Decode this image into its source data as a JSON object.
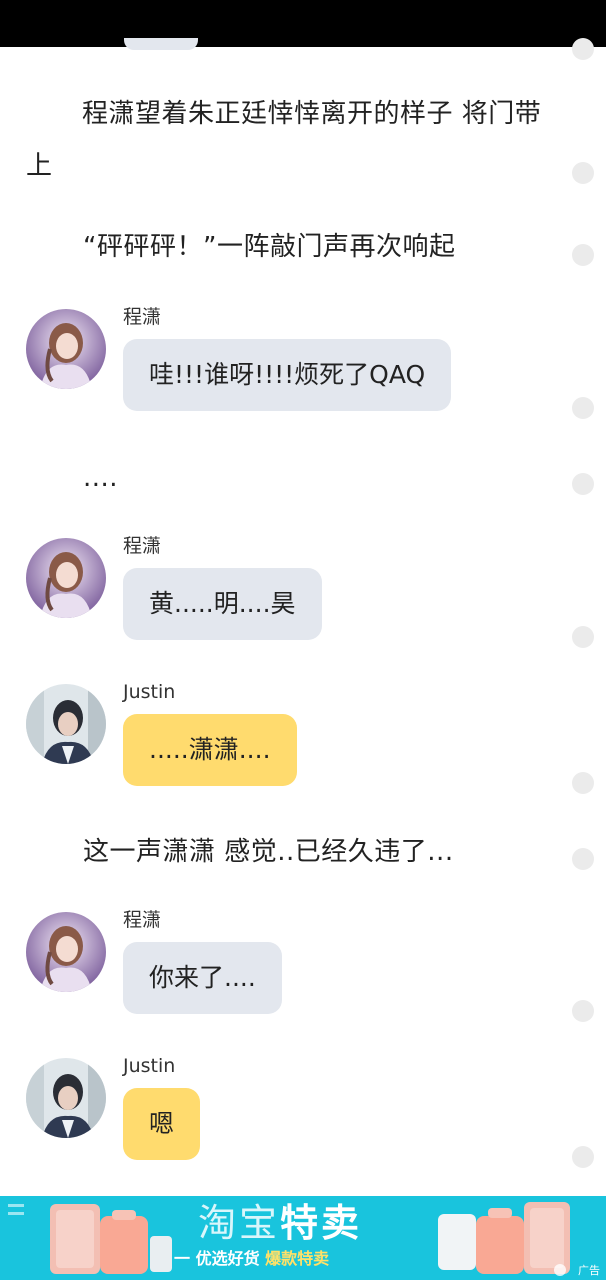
{
  "story": {
    "narration_1": "程潇望着朱正廷悻悻离开的样子 将门带上",
    "narration_2": "“砰砰砰！”一阵敲门声再次响起",
    "narration_3": "....",
    "narration_4": "这一声潇潇 感觉..已经久违了...",
    "messages": [
      {
        "speaker": "程潇",
        "text": "哇!!!谁呀!!!!烦死了QAQ",
        "style": "grey"
      },
      {
        "speaker": "程潇",
        "text": "黄.....明....昊",
        "style": "grey"
      },
      {
        "speaker": "Justin",
        "text": ".....潇潇....",
        "style": "yellow"
      },
      {
        "speaker": "程潇",
        "text": "你来了....",
        "style": "grey"
      },
      {
        "speaker": "Justin",
        "text": "嗯",
        "style": "yellow"
      }
    ]
  },
  "ad": {
    "title_part1": "淘宝",
    "title_part2": "特卖",
    "subtitle_part1": "一 优选好货",
    "subtitle_part2": "爆款特卖",
    "tag": "广告"
  },
  "colors": {
    "status_bar": "#000000",
    "grey_bubble": "#e3e7ee",
    "yellow_bubble": "#ffdb6e",
    "ad_background": "#19c4dd"
  },
  "icons": [
    "avatar-chengxiao",
    "avatar-justin",
    "ad-close-icon"
  ]
}
